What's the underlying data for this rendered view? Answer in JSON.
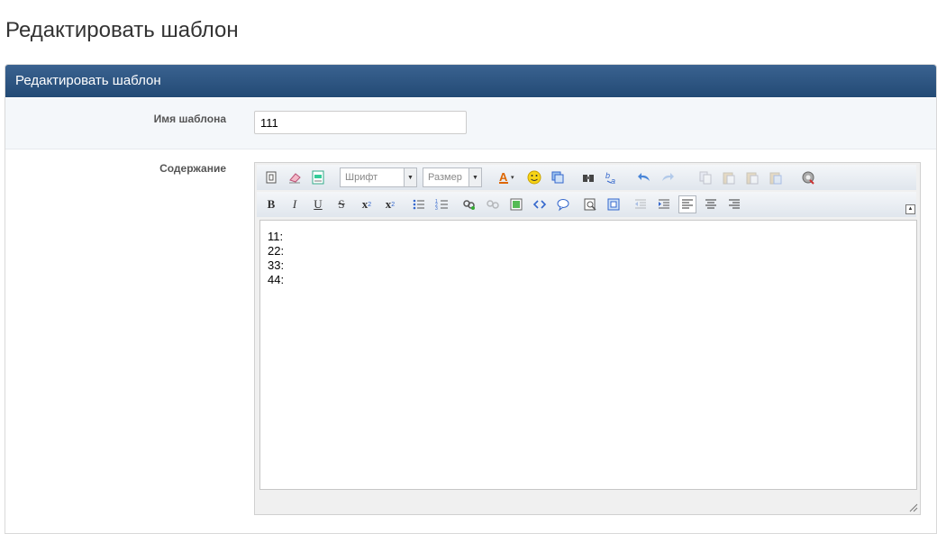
{
  "page": {
    "title": "Редактировать шаблон"
  },
  "panel": {
    "header": "Редактировать шаблон"
  },
  "form": {
    "name_label": "Имя шаблона",
    "name_value": "111",
    "content_label": "Содержание"
  },
  "editor": {
    "font_combo": "Шрифт",
    "size_combo": "Размер",
    "toolbar": {
      "bold": "B",
      "italic": "I",
      "underline": "U",
      "strike": "S",
      "subscript": "x",
      "superscript": "x"
    },
    "content_lines": [
      "11:",
      "22:",
      "33:",
      "44:"
    ]
  },
  "colors": {
    "header_bg": "#2b5078",
    "row_bg": "#f4f7fa",
    "accent": "#3a6290"
  }
}
